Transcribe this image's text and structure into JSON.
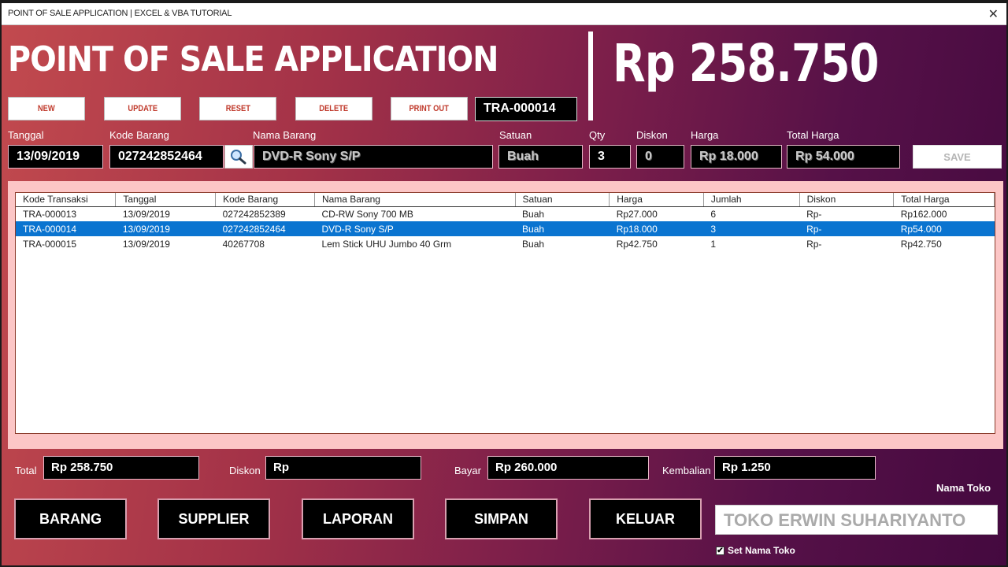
{
  "window": {
    "title": "POINT OF SALE APPLICATION |  EXCEL & VBA TUTORIAL",
    "close_icon": "close-icon"
  },
  "header": {
    "app_title": "POINT OF SALE APPLICATION",
    "grand_total": "Rp 258.750"
  },
  "toolbar": {
    "new_label": "NEW",
    "update_label": "UPDATE",
    "reset_label": "RESET",
    "delete_label": "DELETE",
    "print_label": "PRINT OUT",
    "transaction_code": "TRA-000014"
  },
  "entry": {
    "tanggal_label": "Tanggal",
    "tanggal_value": "13/09/2019",
    "kode_barang_label": "Kode Barang",
    "kode_barang_value": "027242852464",
    "search_icon": "search-icon",
    "nama_barang_label": "Nama Barang",
    "nama_barang_value": "DVD-R Sony S/P",
    "satuan_label": "Satuan",
    "satuan_value": "Buah",
    "qty_label": "Qty",
    "qty_value": "3",
    "diskon_label": "Diskon",
    "diskon_value": "0",
    "harga_label": "Harga",
    "harga_value": "Rp 18.000",
    "total_harga_label": "Total Harga",
    "total_harga_value": "Rp 54.000",
    "save_label": "SAVE"
  },
  "table": {
    "columns": [
      "Kode Transaksi",
      "Tanggal",
      "Kode Barang",
      "Nama Barang",
      "Satuan",
      "Harga",
      "Jumlah",
      "Diskon",
      "Total Harga"
    ],
    "rows": [
      [
        "TRA-000013",
        "13/09/2019",
        "027242852389",
        "CD-RW Sony 700 MB",
        "Buah",
        "Rp27.000",
        "6",
        "Rp-",
        "Rp162.000"
      ],
      [
        "TRA-000014",
        "13/09/2019",
        "027242852464",
        "DVD-R Sony S/P",
        "Buah",
        "Rp18.000",
        "3",
        "Rp-",
        "Rp54.000"
      ],
      [
        "TRA-000015",
        "13/09/2019",
        "40267708",
        "Lem Stick UHU Jumbo 40 Grm",
        "Buah",
        "Rp42.750",
        "1",
        "Rp-",
        "Rp42.750"
      ]
    ],
    "selected_row": 1,
    "selection_color": "#0a74d0"
  },
  "summary": {
    "total_label": "Total",
    "total_value": "Rp 258.750",
    "diskon_label": "Diskon",
    "diskon_value": "Rp",
    "bayar_label": "Bayar",
    "bayar_value": "Rp 260.000",
    "kembalian_label": "Kembalian",
    "kembalian_value": "Rp 1.250"
  },
  "nav": {
    "barang_label": "BARANG",
    "supplier_label": "SUPPLIER",
    "laporan_label": "LAPORAN",
    "simpan_label": "SIMPAN",
    "keluar_label": "KELUAR"
  },
  "store": {
    "nama_toko_label": "Nama Toko",
    "nama_toko_value": "TOKO ERWIN SUHARIYANTO",
    "set_nama_toko_label": "Set Nama Toko",
    "set_nama_toko_checked": true
  }
}
